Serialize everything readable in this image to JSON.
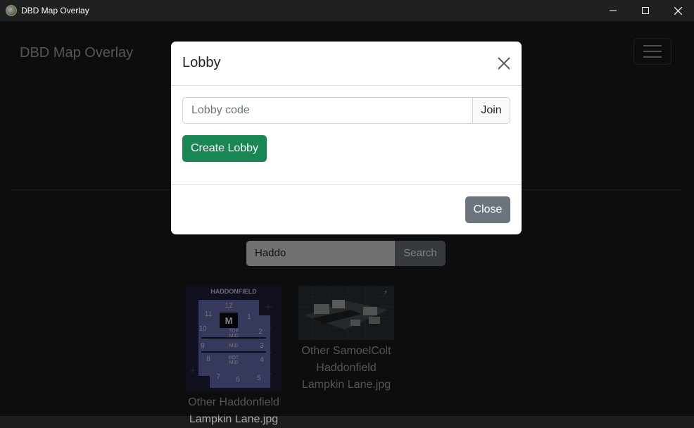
{
  "window": {
    "title": "DBD Map Overlay"
  },
  "navbar": {
    "brand": "DBD Map Overlay"
  },
  "search": {
    "value": "Haddo",
    "button_label": "Search"
  },
  "results": [
    {
      "thumb_label": "HADDONFIELD",
      "caption_line1": "Other Haddonfield",
      "caption_line2": "Lampkin Lane.jpg",
      "map_numbers": [
        "12",
        "11",
        "1",
        "10",
        "2",
        "9",
        "3",
        "8",
        "4",
        "7",
        "6",
        "5"
      ],
      "map_marker": "M",
      "map_labels": [
        "TOP",
        "MID",
        "MID",
        "BOT",
        "MID"
      ]
    },
    {
      "caption_line1": "Other SamoelColt",
      "caption_line2": "Haddonfield",
      "caption_line3": "Lampkin Lane.jpg"
    }
  ],
  "modal": {
    "title": "Lobby",
    "lobby_placeholder": "Lobby code",
    "join_label": "Join",
    "create_label": "Create Lobby",
    "close_label": "Close"
  },
  "colors": {
    "success": "#198754",
    "secondary": "#6c757d"
  },
  "icons": {
    "window_icon": "app-icon",
    "minimize": "minimize-icon",
    "maximize": "maximize-icon",
    "close": "close-icon",
    "menu": "hamburger-icon",
    "modal_close": "close-icon"
  }
}
